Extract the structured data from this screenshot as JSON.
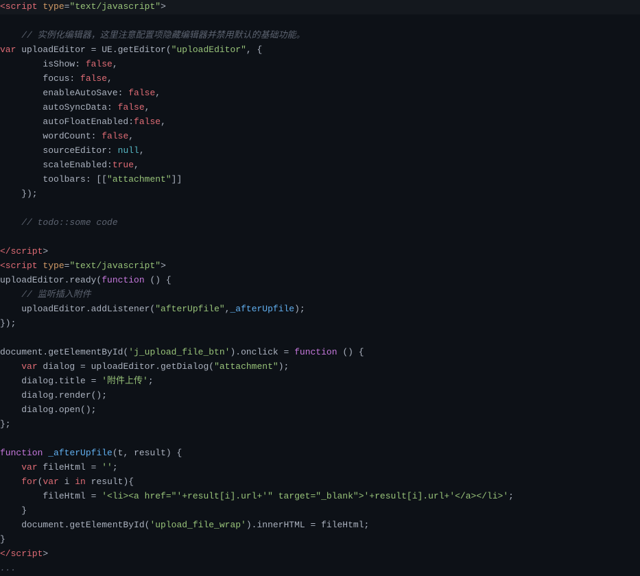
{
  "editor": {
    "background": "#0d1117",
    "lines": [
      {
        "num": "",
        "tokens": [
          {
            "type": "tag",
            "text": "<script"
          },
          {
            "type": "plain",
            "text": " "
          },
          {
            "type": "attr",
            "text": "type"
          },
          {
            "type": "plain",
            "text": "="
          },
          {
            "type": "str",
            "text": "\"text/javascript\""
          },
          {
            "type": "plain",
            "text": ">"
          }
        ]
      },
      {
        "num": "",
        "tokens": []
      },
      {
        "num": "",
        "tokens": [
          {
            "type": "comment",
            "text": "    // 实例化编辑器，这里注意配置项隐藏编辑器并禁用默认的基础功能。"
          }
        ]
      },
      {
        "num": "",
        "tokens": [
          {
            "type": "kw2",
            "text": "var"
          },
          {
            "type": "plain",
            "text": " uploadEditor = UE.getEditor("
          },
          {
            "type": "str",
            "text": "\"uploadEditor\""
          },
          {
            "type": "plain",
            "text": ", {"
          }
        ]
      },
      {
        "num": "",
        "tokens": [
          {
            "type": "plain",
            "text": "        isShow: "
          },
          {
            "type": "true",
            "text": "false"
          },
          {
            "type": "plain",
            "text": ","
          }
        ]
      },
      {
        "num": "",
        "tokens": [
          {
            "type": "plain",
            "text": "        focus: "
          },
          {
            "type": "true",
            "text": "false"
          },
          {
            "type": "plain",
            "text": ","
          }
        ]
      },
      {
        "num": "",
        "tokens": [
          {
            "type": "plain",
            "text": "        enableAutoSave: "
          },
          {
            "type": "true",
            "text": "false"
          },
          {
            "type": "plain",
            "text": ","
          }
        ]
      },
      {
        "num": "",
        "tokens": [
          {
            "type": "plain",
            "text": "        autoSyncData: "
          },
          {
            "type": "true",
            "text": "false"
          },
          {
            "type": "plain",
            "text": ","
          }
        ]
      },
      {
        "num": "",
        "tokens": [
          {
            "type": "plain",
            "text": "        autoFloatEnabled:"
          },
          {
            "type": "true",
            "text": "false"
          },
          {
            "type": "plain",
            "text": ","
          }
        ]
      },
      {
        "num": "",
        "tokens": [
          {
            "type": "plain",
            "text": "        wordCount: "
          },
          {
            "type": "true",
            "text": "false"
          },
          {
            "type": "plain",
            "text": ","
          }
        ]
      },
      {
        "num": "",
        "tokens": [
          {
            "type": "plain",
            "text": "        sourceEditor: "
          },
          {
            "type": "null",
            "text": "null"
          },
          {
            "type": "plain",
            "text": ","
          }
        ]
      },
      {
        "num": "",
        "tokens": [
          {
            "type": "plain",
            "text": "        scaleEnabled:"
          },
          {
            "type": "true",
            "text": "true"
          },
          {
            "type": "plain",
            "text": ","
          }
        ]
      },
      {
        "num": "",
        "tokens": [
          {
            "type": "plain",
            "text": "        toolbars: [["
          },
          {
            "type": "str",
            "text": "\"attachment\""
          },
          {
            "type": "plain",
            "text": "]]"
          }
        ]
      },
      {
        "num": "",
        "tokens": [
          {
            "type": "plain",
            "text": "    });"
          }
        ]
      },
      {
        "num": "",
        "tokens": []
      },
      {
        "num": "",
        "tokens": [
          {
            "type": "comment",
            "text": "    // todo::some code"
          }
        ]
      },
      {
        "num": "",
        "tokens": []
      },
      {
        "num": "",
        "tokens": [
          {
            "type": "tag",
            "text": "</script"
          },
          {
            "type": "plain",
            "text": ">"
          }
        ]
      },
      {
        "num": "",
        "tokens": [
          {
            "type": "tag",
            "text": "<script"
          },
          {
            "type": "plain",
            "text": " "
          },
          {
            "type": "attr",
            "text": "type"
          },
          {
            "type": "plain",
            "text": "="
          },
          {
            "type": "str",
            "text": "\"text/javascript\""
          },
          {
            "type": "plain",
            "text": ">"
          }
        ]
      },
      {
        "num": "",
        "tokens": [
          {
            "type": "plain",
            "text": "uploadEditor.ready("
          },
          {
            "type": "fn-kw",
            "text": "function"
          },
          {
            "type": "plain",
            "text": " () {"
          }
        ]
      },
      {
        "num": "",
        "tokens": [
          {
            "type": "comment",
            "text": "    // 监听插入附件"
          }
        ]
      },
      {
        "num": "",
        "tokens": [
          {
            "type": "plain",
            "text": "    uploadEditor.addListener("
          },
          {
            "type": "str",
            "text": "\"afterUpfile\""
          },
          {
            "type": "plain",
            "text": ","
          },
          {
            "type": "fn-name",
            "text": "_afterUpfile"
          },
          {
            "type": "plain",
            "text": ");"
          }
        ]
      },
      {
        "num": "",
        "tokens": [
          {
            "type": "plain",
            "text": "});"
          }
        ]
      },
      {
        "num": "",
        "tokens": []
      },
      {
        "num": "",
        "tokens": [
          {
            "type": "plain",
            "text": "document.getElementById("
          },
          {
            "type": "str",
            "text": "'j_upload_file_btn'"
          },
          {
            "type": "plain",
            "text": ").onclick = "
          },
          {
            "type": "fn-kw",
            "text": "function"
          },
          {
            "type": "plain",
            "text": " () {"
          }
        ]
      },
      {
        "num": "",
        "tokens": [
          {
            "type": "plain",
            "text": "    "
          },
          {
            "type": "kw2",
            "text": "var"
          },
          {
            "type": "plain",
            "text": " dialog = uploadEditor.getDialog("
          },
          {
            "type": "str",
            "text": "\"attachment\""
          },
          {
            "type": "plain",
            "text": ");"
          }
        ]
      },
      {
        "num": "",
        "tokens": [
          {
            "type": "plain",
            "text": "    dialog.title = "
          },
          {
            "type": "str",
            "text": "'附件上传'"
          },
          {
            "type": "plain",
            "text": ";"
          }
        ]
      },
      {
        "num": "",
        "tokens": [
          {
            "type": "plain",
            "text": "    dialog.render();"
          }
        ]
      },
      {
        "num": "",
        "tokens": [
          {
            "type": "plain",
            "text": "    dialog.open();"
          }
        ]
      },
      {
        "num": "",
        "tokens": [
          {
            "type": "plain",
            "text": "};"
          }
        ]
      },
      {
        "num": "",
        "tokens": []
      },
      {
        "num": "",
        "tokens": [
          {
            "type": "fn-kw",
            "text": "function"
          },
          {
            "type": "plain",
            "text": " "
          },
          {
            "type": "fn-name",
            "text": "_afterUpfile"
          },
          {
            "type": "plain",
            "text": "(t, result) {"
          }
        ]
      },
      {
        "num": "",
        "tokens": [
          {
            "type": "plain",
            "text": "    "
          },
          {
            "type": "kw2",
            "text": "var"
          },
          {
            "type": "plain",
            "text": " fileHtml = "
          },
          {
            "type": "str",
            "text": "''"
          },
          {
            "type": "plain",
            "text": ";"
          }
        ]
      },
      {
        "num": "",
        "tokens": [
          {
            "type": "plain",
            "text": "    "
          },
          {
            "type": "kw2",
            "text": "for"
          },
          {
            "type": "plain",
            "text": "("
          },
          {
            "type": "kw2",
            "text": "var"
          },
          {
            "type": "plain",
            "text": " i "
          },
          {
            "type": "kw2",
            "text": "in"
          },
          {
            "type": "plain",
            "text": " result){"
          }
        ]
      },
      {
        "num": "",
        "tokens": [
          {
            "type": "plain",
            "text": "        fileHtml = "
          },
          {
            "type": "str",
            "text": "'<li><a href=\"'+result[i].url+'\" target=\"_blank\">'+result[i].url+'</a></li>'"
          },
          {
            "type": "plain",
            "text": ";"
          }
        ]
      },
      {
        "num": "",
        "tokens": [
          {
            "type": "plain",
            "text": "    }"
          }
        ]
      },
      {
        "num": "",
        "tokens": [
          {
            "type": "plain",
            "text": "    document.getElementById("
          },
          {
            "type": "str",
            "text": "'upload_file_wrap'"
          },
          {
            "type": "plain",
            "text": ").innerHTML = fileHtml;"
          }
        ]
      },
      {
        "num": "",
        "tokens": [
          {
            "type": "plain",
            "text": "}"
          }
        ]
      },
      {
        "num": "",
        "tokens": [
          {
            "type": "tag",
            "text": "</script"
          },
          {
            "type": "plain",
            "text": ">"
          }
        ]
      },
      {
        "num": "",
        "tokens": [
          {
            "type": "comment",
            "text": "..."
          }
        ]
      }
    ]
  }
}
